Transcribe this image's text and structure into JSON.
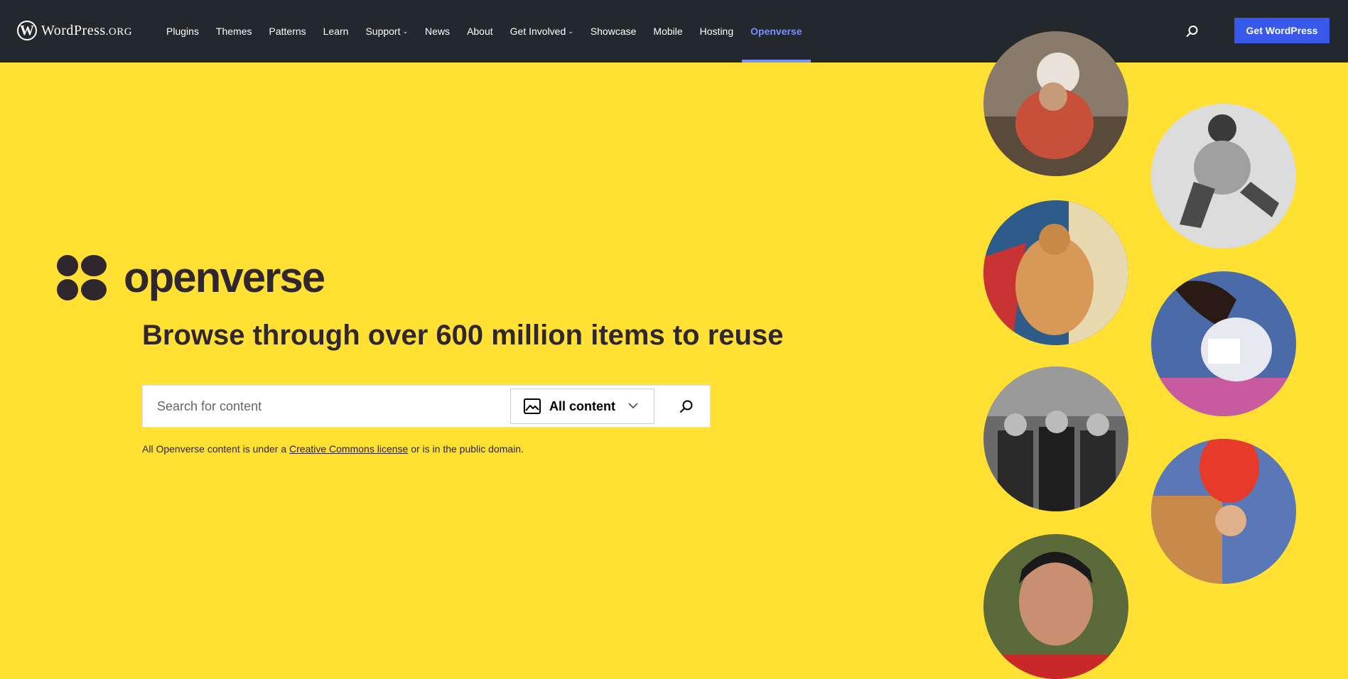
{
  "header": {
    "logo_text": "WordPress",
    "logo_suffix": ".ORG",
    "nav": [
      {
        "label": "Plugins"
      },
      {
        "label": "Themes"
      },
      {
        "label": "Patterns"
      },
      {
        "label": "Learn"
      },
      {
        "label": "Support"
      },
      {
        "label": "News"
      },
      {
        "label": "About"
      },
      {
        "label": "Get Involved"
      },
      {
        "label": "Showcase"
      },
      {
        "label": "Mobile"
      },
      {
        "label": "Hosting"
      },
      {
        "label": "Openverse"
      }
    ],
    "cta_label": "Get WordPress"
  },
  "hero": {
    "brand": "openverse",
    "headline": "Browse through over 600 million items to reuse",
    "search": {
      "placeholder": "Search for content",
      "content_type": "All content"
    },
    "license_prefix": "All Openverse content is under a ",
    "license_link": "Creative Commons license",
    "license_suffix": " or is in the public domain."
  },
  "colors": {
    "topbar": "#23282d",
    "hero_bg": "#ffe033",
    "accent": "#3858e9",
    "active_nav": "#7b90ff"
  }
}
